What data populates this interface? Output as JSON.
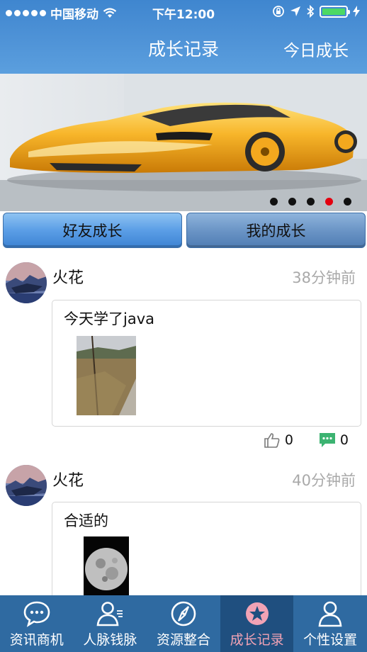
{
  "status_bar": {
    "carrier": "中国移动",
    "time": "下午12:00"
  },
  "nav": {
    "title": "成长记录",
    "right_action": "今日成长"
  },
  "banner": {
    "page_count": 5,
    "active_page": 4
  },
  "segments": {
    "friends": "好友成长",
    "mine": "我的成长"
  },
  "posts": [
    {
      "user": "火花",
      "time": "38分钟前",
      "text": "今天学了java",
      "likes": "0",
      "comments": "0"
    },
    {
      "user": "火花",
      "time": "40分钟前",
      "text": "合适的"
    }
  ],
  "tabbar": {
    "items": [
      {
        "label": "资讯商机",
        "icon": "chat-bubble-icon"
      },
      {
        "label": "人脉钱脉",
        "icon": "contacts-icon"
      },
      {
        "label": "资源整合",
        "icon": "compass-icon"
      },
      {
        "label": "成长记录",
        "icon": "star-badge-icon"
      },
      {
        "label": "个性设置",
        "icon": "person-icon"
      }
    ],
    "active_index": 3
  },
  "colors": {
    "nav_bar": "#4a8fd6",
    "tab_bar": "#2f6aa1",
    "tab_active": "#1f4f7f",
    "active_label": "#f2a3b5",
    "pager_active": "#e3000f",
    "comment_icon": "#3cb371"
  }
}
